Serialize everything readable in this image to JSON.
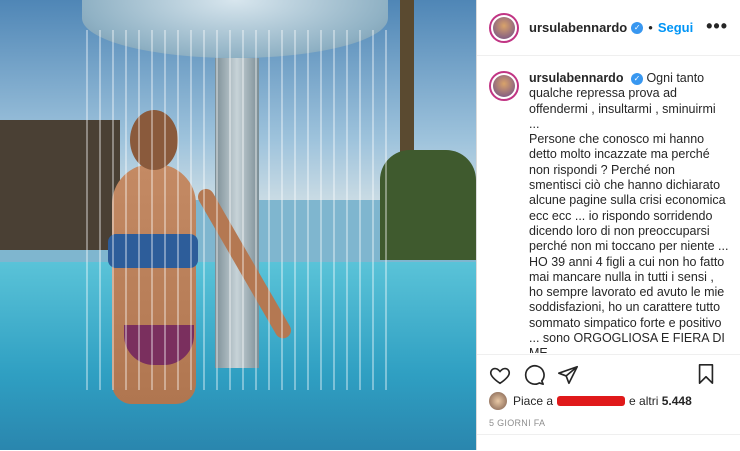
{
  "header": {
    "username": "ursulabennardo",
    "separator": "•",
    "follow_label": "Segui",
    "more_label": "•••"
  },
  "caption": {
    "username": "ursulabennardo",
    "text": "Ogni tanto qualche repressa prova ad offendermi , insultarmi , sminuirmi ...\nPersone che conosco mi hanno detto molto incazzate ma perché non rispondi ? Perché non smentisci ciò che hanno dichiarato alcune pagine sulla crisi economica ecc ecc ... io rispondo sorridendo dicendo loro di non preoccuparsi perché non mi toccano per niente ... HO 39 anni 4 figli a cui non ho fatto mai mancare nulla in tutti i sensi , ho sempre lavorato ed avuto le mie soddisfazioni, ho un carattere tutto sommato simpatico forte e positivo ... sono ORGOGLIOSA E FIERA DI ME\noggi ???? Non mi manca nulla se non vedere i miei figli realizzati e sereni !!!\nCome ostori Forse revisare l'umore da"
  },
  "icons": {
    "like": "heart-icon",
    "comment": "comment-icon",
    "share": "share-icon",
    "save": "bookmark-icon",
    "verified": "verified-badge-icon"
  },
  "likes": {
    "prefix": "Piace a",
    "suffix": "e altri",
    "count": "5.448"
  },
  "timestamp": "5 GIORNI FA",
  "colors": {
    "follow": "#0095f6",
    "verified": "#3897f0",
    "redaction": "#e0191a"
  }
}
